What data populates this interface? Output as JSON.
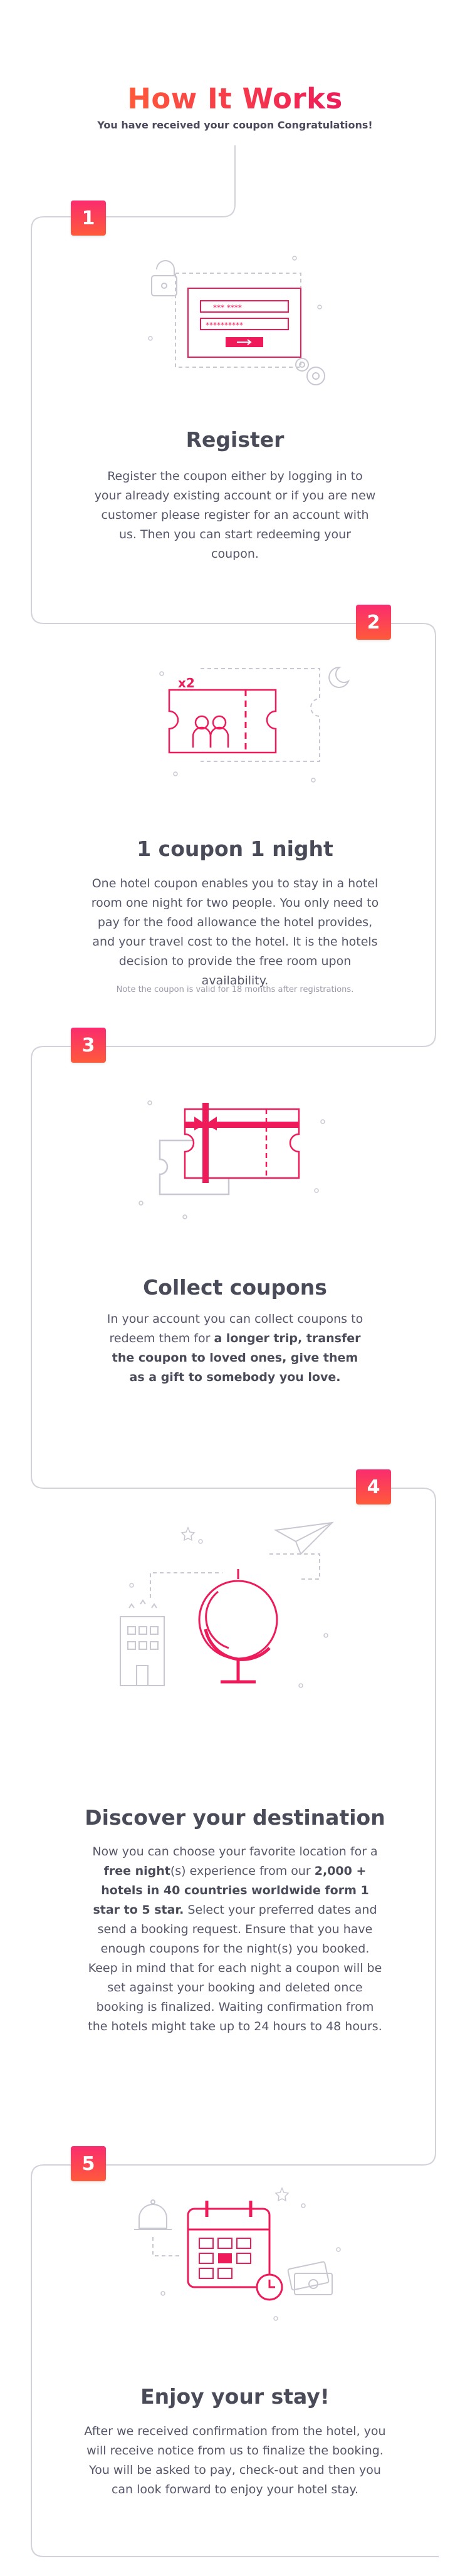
{
  "header": {
    "title": "How It Works",
    "subtitle": "You have received your coupon Congratulations!"
  },
  "colors": {
    "accent": "#ee1a5a",
    "accent_orange": "#ff5a3a",
    "line": "#d6d6de",
    "text": "#4a4b59"
  },
  "steps": [
    {
      "number": "1",
      "title": "Register",
      "text": "Register the coupon either by logging in to your already existing account or if you are new customer please register for an account with us. Then you can start redeeming your coupon.",
      "icon": "register-form-icon"
    },
    {
      "number": "2",
      "title": "1 coupon 1 night",
      "text": "One hotel coupon enables you to stay in a hotel room one night for two people. You only need to pay for the food allowance the hotel provides, and your travel cost to the hotel. It is the hotels decision to provide the free room upon availability.",
      "note": "Note the coupon is valid for 18 months after registrations.",
      "badge_label": "x2",
      "icon": "coupon-ticket-icon"
    },
    {
      "number": "3",
      "title": "Collect coupons",
      "text_parts": [
        "In your account you can collect coupons to redeem them for ",
        "a longer trip, transfer the coupon to loved ones, give them as a gift to somebody you love."
      ],
      "icon": "gift-coupon-icon"
    },
    {
      "number": "4",
      "title": "Discover your destination",
      "text_parts": [
        "Now you can choose your favorite location for a ",
        "free night",
        "(s) experience from our ",
        "2,000 + hotels in 40 countries worldwide form 1 star to 5 star.",
        " Select your preferred dates and send a booking request. Ensure that you have enough coupons for the night(s) you booked. Keep in mind that for each night a coupon will be set against your booking and deleted once booking is finalized. Waiting confirmation from the hotels might take up to 24 hours to 48 hours."
      ],
      "icon": "globe-destination-icon"
    },
    {
      "number": "5",
      "title": "Enjoy your stay!",
      "text": "After we received confirmation from the hotel, you will receive notice from us to finalize the booking. You will be asked to pay, check-out and then you can look forward to enjoy your hotel stay.",
      "icon": "calendar-booking-icon"
    }
  ]
}
